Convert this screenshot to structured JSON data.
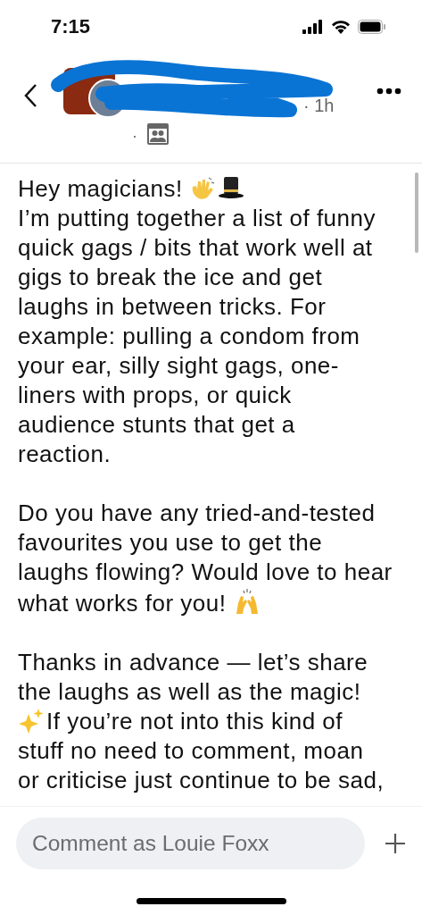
{
  "status_bar": {
    "time": "7:15"
  },
  "header": {
    "time_ago": "· 1h",
    "separator": "·"
  },
  "post": {
    "paragraphs": [
      {
        "lines": [
          [
            {
              "kind": "text",
              "text": "Hey magicians! "
            },
            {
              "kind": "wave"
            },
            {
              "kind": "hat"
            }
          ],
          [
            {
              "kind": "text",
              "text": "I’m putting together a list of funny"
            }
          ],
          [
            {
              "kind": "text",
              "text": "quick gags / bits that work well at"
            }
          ],
          [
            {
              "kind": "text",
              "text": "gigs to break the ice and get"
            }
          ],
          [
            {
              "kind": "text",
              "text": "laughs in between tricks. For"
            }
          ],
          [
            {
              "kind": "text",
              "text": "example: pulling a condom from"
            }
          ],
          [
            {
              "kind": "text",
              "text": "your ear, silly sight gags, one-"
            }
          ],
          [
            {
              "kind": "text",
              "text": "liners with props, or quick"
            }
          ],
          [
            {
              "kind": "text",
              "text": "audience stunts that get a"
            }
          ],
          [
            {
              "kind": "text",
              "text": "reaction."
            }
          ]
        ]
      },
      {
        "lines": [
          [
            {
              "kind": "text",
              "text": "Do you have any tried-and-tested"
            }
          ],
          [
            {
              "kind": "text",
              "text": "favourites you use to get the"
            }
          ],
          [
            {
              "kind": "text",
              "text": "laughs flowing? Would love to hear"
            }
          ],
          [
            {
              "kind": "text",
              "text": "what works for you! "
            },
            {
              "kind": "raised_hands"
            }
          ]
        ]
      },
      {
        "lines": [
          [
            {
              "kind": "text",
              "text": "Thanks in advance — let’s share"
            }
          ],
          [
            {
              "kind": "text",
              "text": "the laughs as well as the magic!"
            }
          ],
          [
            {
              "kind": "sparkles"
            },
            {
              "kind": "text",
              "text": "If you’re not into this kind of"
            }
          ],
          [
            {
              "kind": "text",
              "text": "stuff no need to comment, moan"
            }
          ],
          [
            {
              "kind": "text",
              "text": "or criticise just continue to be sad,"
            }
          ]
        ]
      }
    ]
  },
  "composer": {
    "placeholder": "Comment as Louie Foxx"
  }
}
